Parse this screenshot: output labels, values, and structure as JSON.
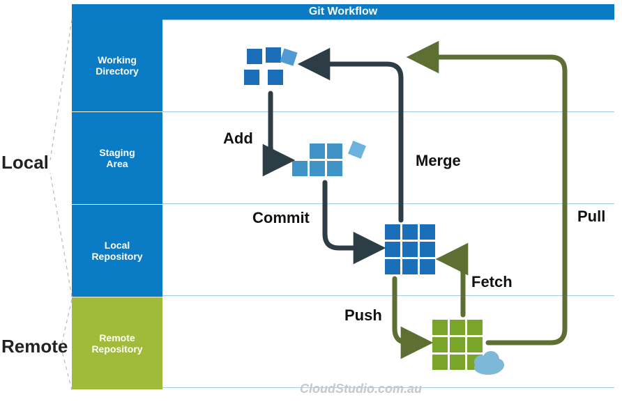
{
  "header": {
    "title": "Git Workflow"
  },
  "categories": {
    "local_label": "Local",
    "remote_label": "Remote"
  },
  "rows": [
    {
      "id": "working-directory",
      "label": "Working\nDirectory",
      "group": "local"
    },
    {
      "id": "staging-area",
      "label": "Staging\nArea",
      "group": "local"
    },
    {
      "id": "local-repository",
      "label": "Local\nRepository",
      "group": "local"
    },
    {
      "id": "remote-repository",
      "label": "Remote\nRepository",
      "group": "remote"
    }
  ],
  "operations": {
    "add": "Add",
    "commit": "Commit",
    "push": "Push",
    "fetch": "Fetch",
    "merge": "Merge",
    "pull": "Pull"
  },
  "watermark": "CloudStudio.com.au",
  "colors": {
    "azure_blue": "#0a7cc6",
    "staging_blue": "#3f93c6",
    "local_repo_blue": "#1a6fb8",
    "remote_green": "#a0bb3a",
    "remote_grid_green": "#7aa52b",
    "arrow_dark": "#2d3d46",
    "arrow_olive": "#5d6f33",
    "cloud": "#7db8d8",
    "grid_line": "#9fc9e6"
  },
  "diagram_edges": [
    {
      "op": "add",
      "from": "working-directory",
      "to": "staging-area"
    },
    {
      "op": "commit",
      "from": "staging-area",
      "to": "local-repository"
    },
    {
      "op": "push",
      "from": "local-repository",
      "to": "remote-repository"
    },
    {
      "op": "fetch",
      "from": "remote-repository",
      "to": "local-repository"
    },
    {
      "op": "merge",
      "from": "local-repository",
      "to": "working-directory"
    },
    {
      "op": "pull",
      "from": "remote-repository",
      "to": "working-directory"
    }
  ]
}
